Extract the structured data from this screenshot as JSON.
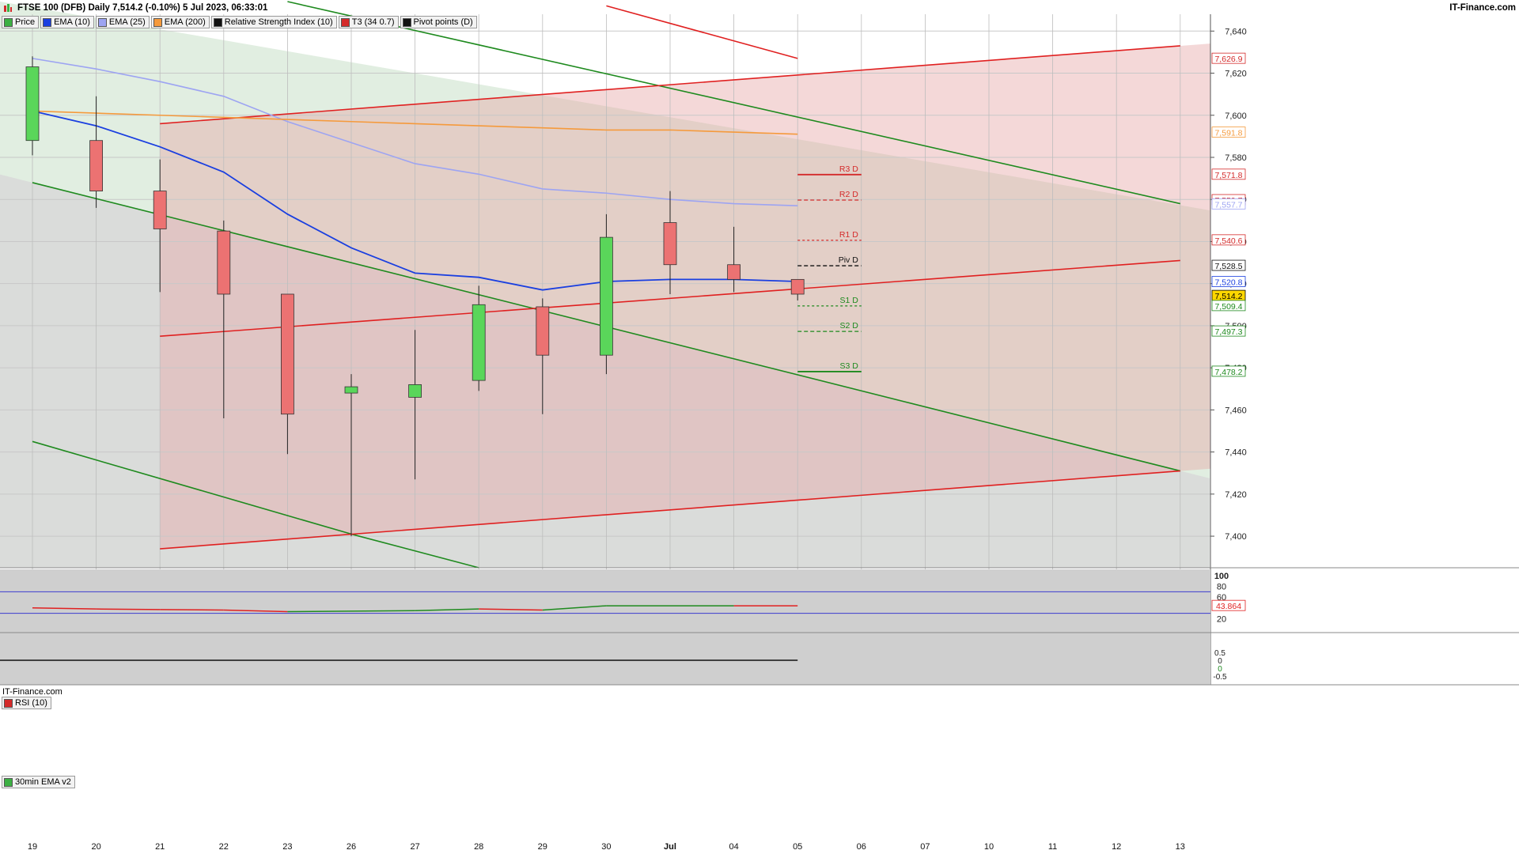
{
  "header": {
    "title": "FTSE 100 (DFB) Daily 7,514.2 (-0.10%) 5 Jul 2023, 06:33:01",
    "brand": "IT-Finance.com",
    "watermark": "IT-Finance.com"
  },
  "legend": [
    {
      "label": "Price",
      "color": "#3cb043"
    },
    {
      "label": "EMA (10)",
      "color": "#1a3fe0"
    },
    {
      "label": "EMA (25)",
      "color": "#9da4f2"
    },
    {
      "label": "EMA (200)",
      "color": "#f59a3c"
    },
    {
      "label": "Relative Strength Index (10)",
      "color": "#111111"
    },
    {
      "label": "T3 (34 0.7)",
      "color": "#d42a2a"
    },
    {
      "label": "Pivot points (D)",
      "color": "#111111"
    }
  ],
  "panels": {
    "rsi_label": "RSI (10)",
    "ema30_label": "30min EMA v2"
  },
  "chart_data": [
    {
      "type": "candlestick",
      "title": "FTSE 100 (DFB) Daily",
      "x": [
        "19",
        "20",
        "21",
        "22",
        "23",
        "26",
        "27",
        "28",
        "29",
        "30",
        "Jul",
        "04",
        "05",
        "06",
        "07",
        "10",
        "11",
        "12",
        "13"
      ],
      "ylim": [
        7385,
        7648
      ],
      "y_ticks": [
        "7,640",
        "7,620",
        "7,600",
        "7,580",
        "7,560",
        "7,540",
        "7,520",
        "7,500",
        "7,480",
        "7,460",
        "7,440",
        "7,420",
        "7,400"
      ],
      "candles": [
        {
          "x": "19",
          "open": 7588,
          "high": 7628,
          "low": 7581,
          "close": 7623
        },
        {
          "x": "20",
          "open": 7588,
          "high": 7609,
          "low": 7556,
          "close": 7564
        },
        {
          "x": "21",
          "open": 7564,
          "high": 7579,
          "low": 7516,
          "close": 7546
        },
        {
          "x": "22",
          "open": 7545,
          "high": 7550,
          "low": 7456,
          "close": 7515
        },
        {
          "x": "23",
          "open": 7515,
          "high": 7515,
          "low": 7439,
          "close": 7458
        },
        {
          "x": "26",
          "open": 7468,
          "high": 7477,
          "low": 7400,
          "close": 7471
        },
        {
          "x": "27",
          "open": 7466,
          "high": 7498,
          "low": 7427,
          "close": 7472
        },
        {
          "x": "28",
          "open": 7474,
          "high": 7519,
          "low": 7469,
          "close": 7510
        },
        {
          "x": "29",
          "open": 7509,
          "high": 7513,
          "low": 7458,
          "close": 7486
        },
        {
          "x": "30",
          "open": 7486,
          "high": 7553,
          "low": 7477,
          "close": 7542
        },
        {
          "x": "Jul",
          "open": 7549,
          "high": 7564,
          "low": 7515,
          "close": 7529
        },
        {
          "x": "04",
          "open": 7529,
          "high": 7547,
          "low": 7516,
          "close": 7522
        },
        {
          "x": "05",
          "open": 7522,
          "high": 7522,
          "low": 7512,
          "close": 7515
        }
      ],
      "series": [
        {
          "name": "EMA (10)",
          "color": "#1a3fe0",
          "values": [
            7602,
            7595,
            7585,
            7573,
            7553,
            7537,
            7525,
            7523,
            7517,
            7521,
            7522,
            7522,
            7521
          ]
        },
        {
          "name": "EMA (25)",
          "color": "#9da4f2",
          "values": [
            7627,
            7622,
            7616,
            7609,
            7597,
            7587,
            7577,
            7572,
            7565,
            7563,
            7560,
            7558,
            7557
          ]
        },
        {
          "name": "EMA (200)",
          "color": "#f59a3c",
          "values": [
            7602,
            7601,
            7600,
            7599,
            7598,
            7597,
            7596,
            7595,
            7594,
            7593,
            7593,
            7592,
            7591
          ]
        }
      ],
      "pivots": [
        {
          "label": "R3 D",
          "value": 7571.8,
          "color": "#d42a2a",
          "style": "solid"
        },
        {
          "label": "R2 D",
          "value": 7559.7,
          "color": "#d42a2a",
          "style": "dashed"
        },
        {
          "label": "R1 D",
          "value": 7540.6,
          "color": "#d42a2a",
          "style": "dashed-fine"
        },
        {
          "label": "Piv D",
          "value": 7528.5,
          "color": "#111111",
          "style": "dashed"
        },
        {
          "label": "S1 D",
          "value": 7509.4,
          "color": "#1e8a1e",
          "style": "dashed-fine"
        },
        {
          "label": "S2 D",
          "value": 7497.3,
          "color": "#1e8a1e",
          "style": "dashed"
        },
        {
          "label": "S3 D",
          "value": 7478.2,
          "color": "#1e8a1e",
          "style": "solid"
        }
      ],
      "price_labels": [
        {
          "text": "7,626.9",
          "value": 7626.9,
          "color": "#d42a2a",
          "bg": "#ffffff"
        },
        {
          "text": "7,591.8",
          "value": 7591.8,
          "color": "#f59a3c",
          "bg": "#ffffff"
        },
        {
          "text": "7,571.8",
          "value": 7571.8,
          "color": "#d42a2a",
          "bg": "#ffffff"
        },
        {
          "text": "7,559.7",
          "value": 7559.7,
          "color": "#d42a2a",
          "bg": "#ffffff"
        },
        {
          "text": "7,557.7",
          "value": 7557.7,
          "color": "#9da4f2",
          "bg": "#ffffff"
        },
        {
          "text": "7,540.6",
          "value": 7540.6,
          "color": "#d42a2a",
          "bg": "#ffffff"
        },
        {
          "text": "7,528.5",
          "value": 7528.5,
          "color": "#111111",
          "bg": "#ffffff"
        },
        {
          "text": "7,520.8",
          "value": 7520.8,
          "color": "#1a3fe0",
          "bg": "#ffffff"
        },
        {
          "text": "7,514.2",
          "value": 7514.2,
          "color": "#000000",
          "bg": "#ffd700"
        },
        {
          "text": "7,509.4",
          "value": 7509.4,
          "color": "#1e8a1e",
          "bg": "#ffffff"
        },
        {
          "text": "7,497.3",
          "value": 7497.3,
          "color": "#1e8a1e",
          "bg": "#ffffff"
        },
        {
          "text": "7,478.2",
          "value": 7478.2,
          "color": "#1e8a1e",
          "bg": "#ffffff"
        }
      ],
      "trendlines": {
        "green_channel": [
          {
            "from": [
              "19",
              7568
            ],
            "to": [
              "13",
              7431
            ]
          },
          {
            "from": [
              "19",
              7445
            ],
            "to": [
              "26",
              7401
            ]
          },
          {
            "from": [
              "26",
              7401
            ],
            "to": [
              "28",
              7385
            ]
          },
          {
            "from": [
              "23",
              7654
            ],
            "to": [
              "13",
              7558
            ]
          }
        ],
        "red_channel": [
          {
            "from": [
              "21",
              7596
            ],
            "to": [
              "13",
              7633
            ]
          },
          {
            "from": [
              "21",
              7495
            ],
            "to": [
              "13",
              7531
            ]
          },
          {
            "from": [
              "21",
              7394
            ],
            "to": [
              "13",
              7431
            ]
          },
          {
            "from": [
              "30",
              7652
            ],
            "to": [
              "05",
              7627
            ]
          }
        ]
      }
    },
    {
      "type": "line",
      "title": "RSI (10)",
      "ylim": [
        0,
        100
      ],
      "y_ticks": [
        "100",
        "80",
        "60",
        "20"
      ],
      "levels": [
        70,
        30
      ],
      "series": [
        {
          "name": "RSI (10)",
          "values": [
            40,
            38,
            37,
            36,
            33,
            34,
            35,
            38,
            36,
            44,
            44,
            44,
            43.864
          ]
        }
      ],
      "current_label": "43.864"
    },
    {
      "type": "line",
      "title": "30min EMA v2",
      "y_ticks": [
        "0.5",
        "0",
        "0",
        "-0.5"
      ],
      "series": [
        {
          "name": "30min EMA v2",
          "values": [
            0,
            0,
            0,
            0,
            0,
            0,
            0,
            0,
            0,
            0,
            0,
            0,
            0
          ]
        }
      ]
    }
  ]
}
